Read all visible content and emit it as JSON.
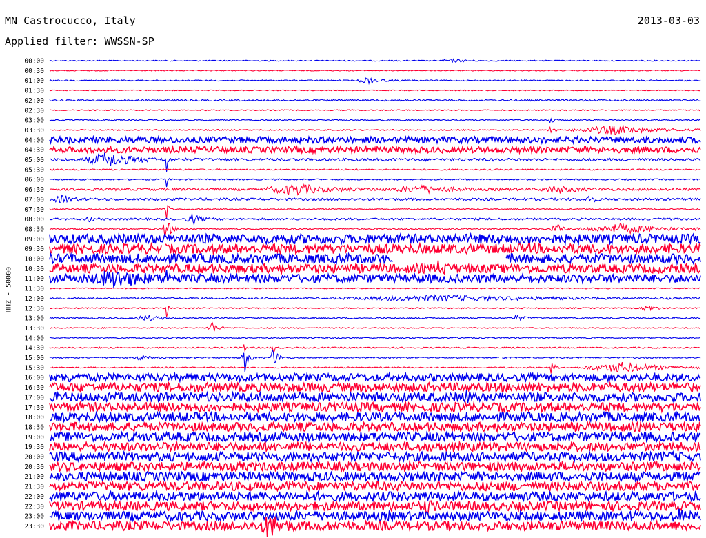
{
  "header": {
    "station": "MN Castrocucco, Italy",
    "filter": "Applied filter: WWSSN-SP",
    "date": "2013-03-03"
  },
  "chart_data": {
    "type": "line",
    "title": "MN Castrocucco, Italy",
    "subtitle": "Applied filter: WWSSN-SP",
    "date": "2013-03-03",
    "ylabel": "HHZ - 50000",
    "colors": {
      "even": "#0000ee",
      "odd": "#ff0033"
    },
    "rows": [
      {
        "label": "00:00",
        "noise": 0.8,
        "events": [
          {
            "x": 0.62,
            "amp": 2,
            "width": 0.04
          }
        ]
      },
      {
        "label": "00:30",
        "noise": 0.7,
        "events": []
      },
      {
        "label": "01:00",
        "noise": 0.9,
        "events": [
          {
            "x": 0.49,
            "amp": 5,
            "width": 0.03
          }
        ]
      },
      {
        "label": "01:30",
        "noise": 0.7,
        "events": []
      },
      {
        "label": "02:00",
        "noise": 1.2,
        "events": []
      },
      {
        "label": "02:30",
        "noise": 0.8,
        "events": []
      },
      {
        "label": "03:00",
        "noise": 0.9,
        "events": [
          {
            "x": 0.77,
            "amp": 12,
            "width": 0.005
          }
        ]
      },
      {
        "label": "03:30",
        "noise": 0.9,
        "events": [
          {
            "x": 0.77,
            "amp": 8,
            "width": 0.01
          },
          {
            "x": 0.87,
            "amp": 6,
            "width": 0.13
          }
        ]
      },
      {
        "label": "04:00",
        "noise": 4.5,
        "events": []
      },
      {
        "label": "04:30",
        "noise": 4.5,
        "events": []
      },
      {
        "label": "05:00",
        "noise": 2.0,
        "events": [
          {
            "x": 0.09,
            "amp": 10,
            "width": 0.07
          },
          {
            "x": 0.18,
            "amp": 22,
            "width": 0.003
          }
        ]
      },
      {
        "label": "05:30",
        "noise": 1.0,
        "events": []
      },
      {
        "label": "06:00",
        "noise": 1.0,
        "events": [
          {
            "x": 0.18,
            "amp": 22,
            "width": 0.003
          }
        ]
      },
      {
        "label": "06:30",
        "noise": 1.8,
        "events": [
          {
            "x": 0.38,
            "amp": 7,
            "width": 0.1
          },
          {
            "x": 0.57,
            "amp": 5,
            "width": 0.08
          },
          {
            "x": 0.78,
            "amp": 5,
            "width": 0.05
          }
        ]
      },
      {
        "label": "07:00",
        "noise": 1.8,
        "events": [
          {
            "x": 0.02,
            "amp": 5,
            "width": 0.03
          },
          {
            "x": 0.83,
            "amp": 9,
            "width": 0.01
          }
        ]
      },
      {
        "label": "07:30",
        "noise": 0.9,
        "events": [
          {
            "x": 0.18,
            "amp": 25,
            "width": 0.004
          }
        ]
      },
      {
        "label": "08:00",
        "noise": 1.5,
        "events": [
          {
            "x": 0.06,
            "amp": 5,
            "width": 0.01
          },
          {
            "x": 0.22,
            "amp": 8,
            "width": 0.02
          }
        ]
      },
      {
        "label": "08:30",
        "noise": 1.0,
        "events": [
          {
            "x": 0.18,
            "amp": 14,
            "width": 0.015
          },
          {
            "x": 0.78,
            "amp": 7,
            "width": 0.02
          },
          {
            "x": 0.88,
            "amp": 7,
            "width": 0.12
          }
        ]
      },
      {
        "label": "09:00",
        "noise": 7.0,
        "events": []
      },
      {
        "label": "09:30",
        "noise": 7.0,
        "events": [],
        "gaps": [
          [
            0.172,
            0.177
          ]
        ]
      },
      {
        "label": "10:00",
        "noise": 7.0,
        "events": [],
        "gaps": [
          [
            0.527,
            0.701
          ]
        ]
      },
      {
        "label": "10:30",
        "noise": 6.5,
        "events": [
          {
            "x": 0.6,
            "amp": 12,
            "width": 0.01
          }
        ]
      },
      {
        "label": "11:00",
        "noise": 6.0,
        "events": [
          {
            "x": 0.1,
            "amp": 9,
            "width": 0.07
          },
          {
            "x": 0.18,
            "amp": 12,
            "width": 0.003
          }
        ]
      },
      {
        "label": "11:30",
        "noise": 0.8,
        "events": []
      },
      {
        "label": "12:00",
        "noise": 1.2,
        "events": [
          {
            "x": 0.6,
            "amp": 4,
            "width": 0.3
          }
        ]
      },
      {
        "label": "12:30",
        "noise": 0.9,
        "events": [
          {
            "x": 0.92,
            "amp": 5,
            "width": 0.02
          },
          {
            "x": 0.18,
            "amp": 20,
            "width": 0.003
          }
        ]
      },
      {
        "label": "13:00",
        "noise": 1.0,
        "events": [
          {
            "x": 0.15,
            "amp": 5,
            "width": 0.03
          },
          {
            "x": 0.72,
            "amp": 4,
            "width": 0.02
          }
        ]
      },
      {
        "label": "13:30",
        "noise": 0.8,
        "events": [
          {
            "x": 0.25,
            "amp": 10,
            "width": 0.015
          }
        ]
      },
      {
        "label": "14:00",
        "noise": 0.9,
        "events": []
      },
      {
        "label": "14:30",
        "noise": 1.0,
        "events": [
          {
            "x": 0.3,
            "amp": 8,
            "width": 0.005
          },
          {
            "x": 0.345,
            "amp": 8,
            "width": 0.005
          }
        ]
      },
      {
        "label": "15:00",
        "noise": 1.0,
        "events": [
          {
            "x": 0.3,
            "amp": 22,
            "width": 0.01
          },
          {
            "x": 0.345,
            "amp": 22,
            "width": 0.01
          },
          {
            "x": 0.14,
            "amp": 4,
            "width": 0.02
          }
        ],
        "gaps": [
          [
            0.691,
            0.694
          ]
        ]
      },
      {
        "label": "15:30",
        "noise": 0.9,
        "events": [
          {
            "x": 0.77,
            "amp": 10,
            "width": 0.01
          },
          {
            "x": 0.88,
            "amp": 7,
            "width": 0.12
          }
        ]
      },
      {
        "label": "16:00",
        "noise": 5.5,
        "events": [
          {
            "x": 0.025,
            "amp": 8,
            "width": 0.01
          }
        ]
      },
      {
        "label": "16:30",
        "noise": 6.5,
        "events": []
      },
      {
        "label": "17:00",
        "noise": 6.5,
        "events": [
          {
            "x": 0.64,
            "amp": 8,
            "width": 0.01
          }
        ]
      },
      {
        "label": "17:30",
        "noise": 6.5,
        "events": []
      },
      {
        "label": "18:00",
        "noise": 6.5,
        "events": []
      },
      {
        "label": "18:30",
        "noise": 6.5,
        "events": []
      },
      {
        "label": "19:00",
        "noise": 6.5,
        "events": []
      },
      {
        "label": "19:30",
        "noise": 6.5,
        "events": []
      },
      {
        "label": "20:00",
        "noise": 6.5,
        "events": []
      },
      {
        "label": "20:30",
        "noise": 6.5,
        "events": []
      },
      {
        "label": "21:00",
        "noise": 6.5,
        "events": []
      },
      {
        "label": "21:30",
        "noise": 6.5,
        "events": []
      },
      {
        "label": "22:00",
        "noise": 6.5,
        "events": []
      },
      {
        "label": "22:30",
        "noise": 6.5,
        "events": [
          {
            "x": 0.58,
            "amp": 8,
            "width": 0.01
          }
        ]
      },
      {
        "label": "23:00",
        "noise": 6.5,
        "events": [
          {
            "x": 0.97,
            "amp": 8,
            "width": 0.01
          }
        ]
      },
      {
        "label": "23:30",
        "noise": 6.5,
        "events": [
          {
            "x": 0.34,
            "amp": 14,
            "width": 0.03
          }
        ]
      }
    ]
  }
}
